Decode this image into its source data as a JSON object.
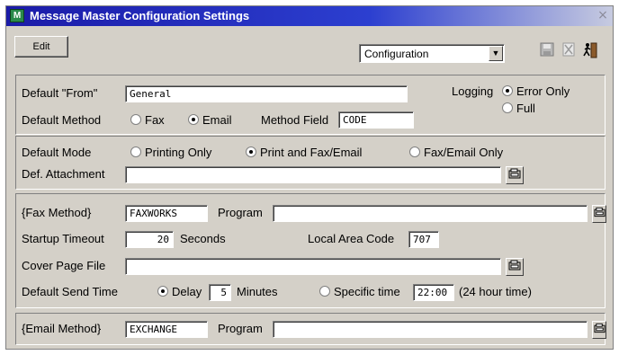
{
  "window": {
    "title": "Message Master Configuration Settings",
    "icon": "app-icon",
    "close": "×"
  },
  "toolbar": {
    "edit_label": "Edit",
    "view_select": "Configuration",
    "icons": [
      "save-icon",
      "delete-icon",
      "exit-icon"
    ]
  },
  "general": {
    "default_from_label": "Default \"From\"",
    "default_from_value": "General",
    "logging_label": "Logging",
    "logging_options": [
      "Error Only",
      "Full"
    ],
    "logging_selected": "Error Only",
    "default_method_label": "Default Method",
    "method_options": [
      "Fax",
      "Email"
    ],
    "method_selected": "Email",
    "method_field_label": "Method Field",
    "method_field_value": "CODE"
  },
  "mode": {
    "default_mode_label": "Default Mode",
    "options": [
      "Printing Only",
      "Print and Fax/Email",
      "Fax/Email Only"
    ],
    "selected": "Print and Fax/Email",
    "attachment_label": "Def. Attachment",
    "attachment_value": ""
  },
  "fax": {
    "method_label": "{Fax Method}",
    "method_value": "FAXWORKS",
    "program_label": "Program",
    "program_value": "",
    "startup_label": "Startup Timeout",
    "startup_value": "20",
    "startup_unit": "Seconds",
    "area_code_label": "Local Area Code",
    "area_code_value": "707",
    "cover_label": "Cover Page File",
    "cover_value": "",
    "send_time_label": "Default Send Time",
    "delay_label": "Delay",
    "delay_value": "5",
    "delay_unit": "Minutes",
    "specific_label": "Specific time",
    "specific_value": "22:00",
    "specific_note": "(24 hour time)",
    "send_selected": "Delay"
  },
  "email": {
    "method_label": "{Email Method}",
    "method_value": "EXCHANGE",
    "program_label": "Program",
    "program_value": ""
  }
}
